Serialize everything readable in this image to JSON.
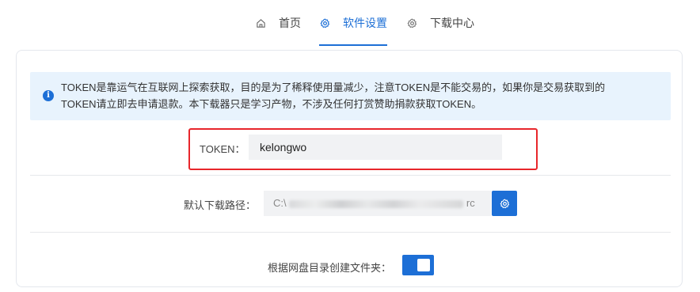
{
  "nav": {
    "tabs": [
      {
        "label": "首页",
        "icon": "home-icon",
        "active": false
      },
      {
        "label": "软件设置",
        "icon": "gear-icon",
        "active": true
      },
      {
        "label": "下载中心",
        "icon": "gear-icon",
        "active": false
      }
    ]
  },
  "notice": {
    "icon": "info-icon",
    "line1": "TOKEN是靠运气在互联网上探索获取，目的是为了稀释使用量减少，注意TOKEN是不能交易的，如果你是交易获取到的",
    "line2": "TOKEN请立即去申请退款。本下载器只是学习产物，不涉及任何打赏赞助捐款获取TOKEN。"
  },
  "token": {
    "label": "TOKEN：",
    "value": "kelongwo"
  },
  "download_path": {
    "label": "默认下载路径：",
    "value_prefix": "C:\\",
    "value_suffix": "rc"
  },
  "folder_option": {
    "label": "根据网盘目录创建文件夹：",
    "enabled": true
  },
  "colors": {
    "accent": "#1d6fd6",
    "notice_bg": "#e8f3fd",
    "highlight_border": "#e8262b"
  }
}
